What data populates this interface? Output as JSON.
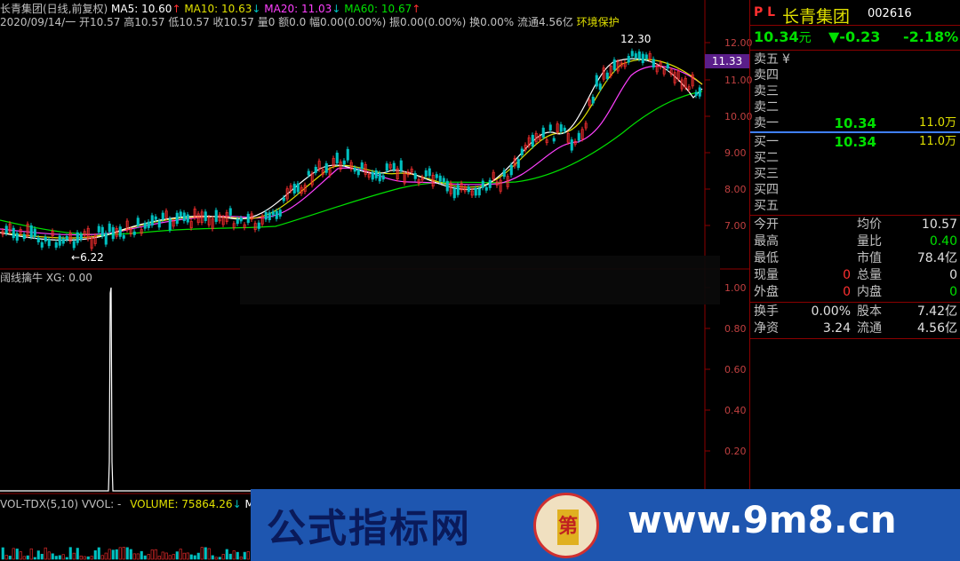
{
  "header": {
    "name": "长青集团(日线,前复权)",
    "ma5": "MA5: 10.60",
    "ma10": "MA10: 10.63",
    "ma20": "MA20: 11.03",
    "ma60": "MA60: 10.67",
    "info": "2020/09/14/一 开10.57 高10.57 低10.57 收10.57 量0 额0.0 幅0.00(0.00%) 振0.00(0.00%) 换0.00% 流通4.56亿",
    "env": "环境保护"
  },
  "main_chart": {
    "high_label": "12.30",
    "low_label": "6.22",
    "current_price_tag": "11.33",
    "y_ticks": [
      "12.00",
      "11.00",
      "10.00",
      "9.00",
      "8.00",
      "7.00"
    ]
  },
  "indicator": {
    "title": "阔线擒牛 XG: 0.00",
    "y_ticks": [
      "1.00",
      "0.80",
      "0.60",
      "0.40",
      "0.20"
    ]
  },
  "volume": {
    "title": "VOL-TDX(5,10) VVOL: -",
    "volume": "VOLUME: 75864.26",
    "ma5": "MA5"
  },
  "quote": {
    "pl": "P L",
    "stock_name": "长青集团",
    "code": "002616",
    "price": "10.34",
    "unit": "元",
    "change": "▼-0.23",
    "change_pct": "-2.18%",
    "sell_labels": [
      "卖五",
      "卖四",
      "卖三",
      "卖二",
      "卖一"
    ],
    "sell_five_extra": "¥",
    "sell_one_price": "10.34",
    "sell_one_vol": "11.0万",
    "buy_labels": [
      "买一",
      "买二",
      "买三",
      "买四",
      "买五"
    ],
    "buy_one_price": "10.34",
    "buy_one_vol": "11.0万",
    "stats": [
      {
        "l": "今开",
        "lv": "",
        "r": "均价",
        "rv": "10.57"
      },
      {
        "l": "最高",
        "lv": "",
        "r": "量比",
        "rv": "0.40"
      },
      {
        "l": "最低",
        "lv": "",
        "r": "市值",
        "rv": "78.4亿"
      },
      {
        "l": "现量",
        "lv": "0",
        "r": "总量",
        "rv": "0"
      },
      {
        "l": "外盘",
        "lv": "0",
        "r": "内盘",
        "rv": "0"
      }
    ],
    "stats2": [
      {
        "l": "换手",
        "lv": "0.00%",
        "r": "股本",
        "rv": "7.42亿"
      },
      {
        "l": "净资",
        "lv": "3.24",
        "r": "流通",
        "rv": "4.56亿"
      }
    ]
  },
  "watermark": {
    "text": "公式指标网",
    "url": "www.9m8.cn",
    "logo_text": "第"
  },
  "colors": {
    "ma5": "#ffffff",
    "ma10": "#ffff00",
    "ma20": "#ff00ff",
    "ma60": "#00ff00",
    "up": "#ff3030",
    "down": "#00c0c0"
  }
}
